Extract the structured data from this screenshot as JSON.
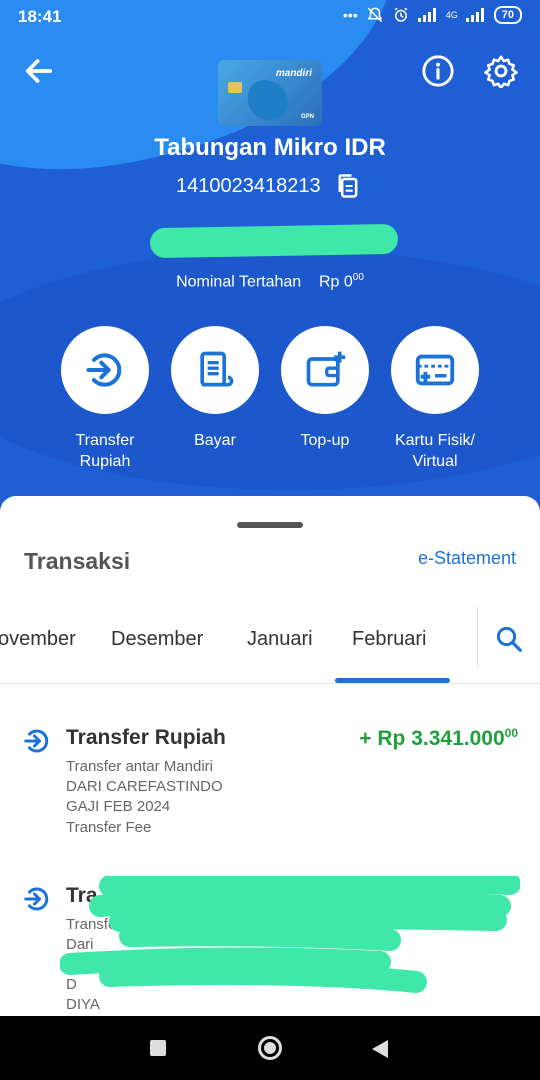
{
  "status_bar": {
    "time": "18:41",
    "dots": "•••",
    "network": "4G",
    "battery": "70"
  },
  "account": {
    "title": "Tabungan Mikro IDR",
    "number": "1410023418213",
    "held_label": "Nominal Tertahan",
    "held_amount": "Rp 0",
    "held_cents": "00",
    "card_brand": "mandiri",
    "card_network": "GPN"
  },
  "actions": [
    {
      "label": "Transfer Rupiah",
      "icon": "transfer-icon"
    },
    {
      "label": "Bayar",
      "icon": "bill-icon"
    },
    {
      "label": "Top-up",
      "icon": "wallet-plus-icon"
    },
    {
      "label": "Kartu Fisik/ Virtual",
      "icon": "card-add-icon"
    }
  ],
  "transactions_section": {
    "title": "Transaksi",
    "estatement_link": "e-Statement",
    "months": [
      "ovember",
      "Desember",
      "Januari",
      "Februari"
    ],
    "selected_month": "Februari"
  },
  "transactions": [
    {
      "title": "Transfer Rupiah",
      "amount": "+ Rp 3.341.000",
      "amount_cents": "00",
      "lines": [
        "Transfer antar Mandiri",
        "DARI CAREFASTINDO",
        "GAJI FEB 2024",
        "Transfer Fee"
      ]
    },
    {
      "title": "Tra",
      "lines": [
        "Transfe",
        "Dari",
        "D",
        "DIYA"
      ]
    }
  ],
  "colors": {
    "primary": "#1f5fd6",
    "accent": "#1b73d8",
    "credit": "#1fa03a",
    "redaction": "#3fe8a8"
  }
}
